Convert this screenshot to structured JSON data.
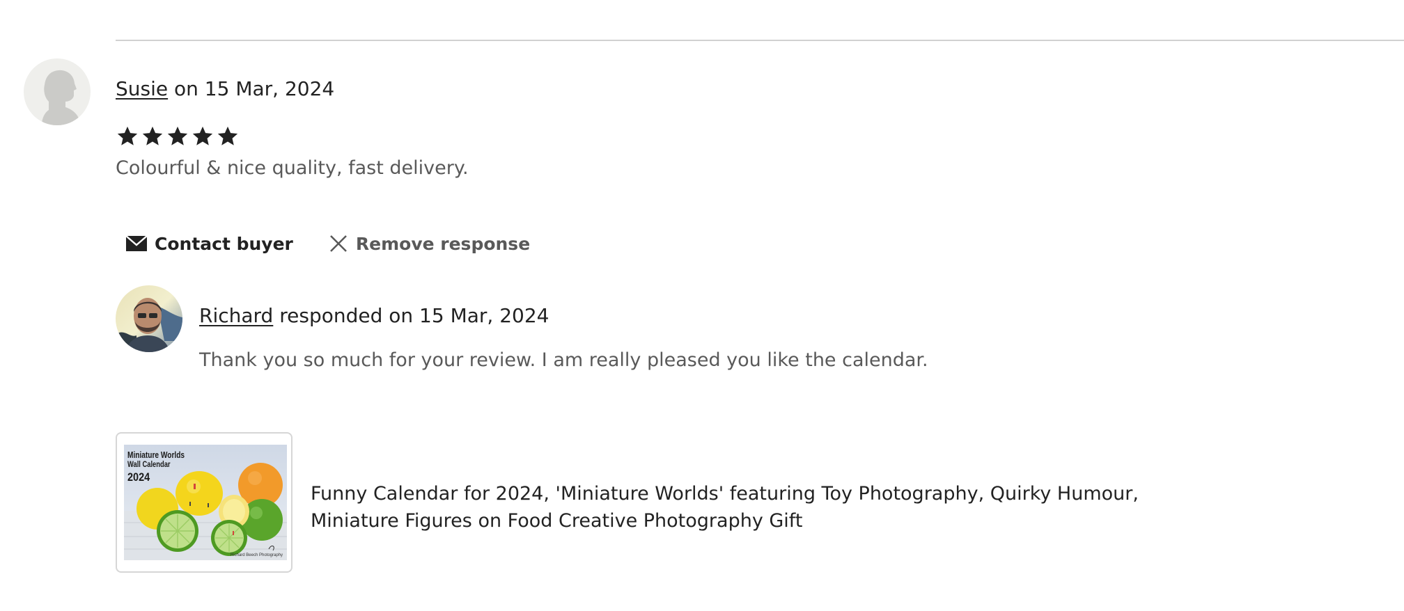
{
  "review": {
    "reviewer_name": "Susie",
    "date_text": " on 15 Mar, 2024",
    "rating": 5,
    "rating_max": 5,
    "text": "Colourful & nice quality, fast delivery."
  },
  "actions": {
    "contact_label": "Contact buyer",
    "remove_label": "Remove response"
  },
  "response": {
    "responder_name": "Richard",
    "date_text": " responded on 15 Mar, 2024",
    "text": "Thank you so much for your review. I am really pleased you like the calendar."
  },
  "listing": {
    "thumb_line1": "Miniature Worlds",
    "thumb_line2": "Wall Calendar",
    "thumb_year": "2024",
    "thumb_credit": "Richard Beech Photography",
    "title": "Funny Calendar for 2024, 'Miniature Worlds' featuring Toy Photography, Quirky Humour, Miniature Figures on Food Creative Photography Gift"
  },
  "colors": {
    "text_primary": "#222222",
    "text_secondary": "#595959",
    "divider": "#d1d1d1",
    "star": "#222222"
  },
  "icons": {
    "contact": "envelope-icon",
    "remove": "close-icon",
    "rating": "star-icon"
  }
}
